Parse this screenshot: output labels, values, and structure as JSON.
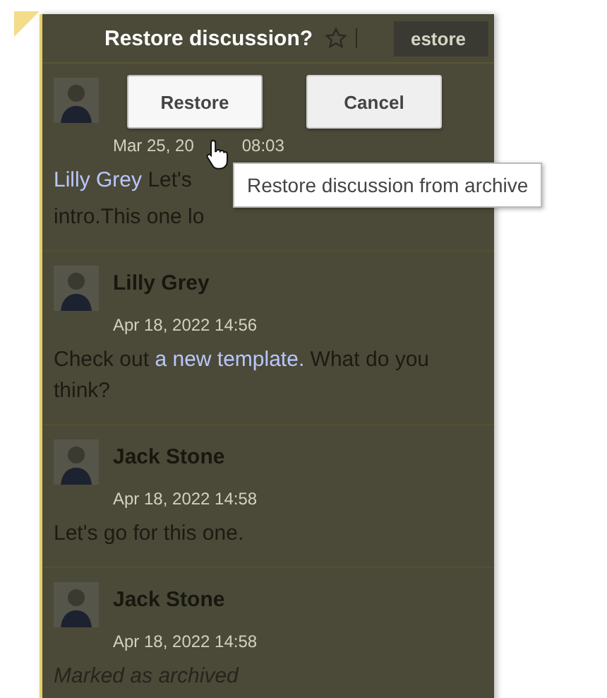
{
  "header": {
    "button": "estore"
  },
  "dialog": {
    "title": "Restore discussion?",
    "buttons": [
      {
        "label": "Restore",
        "hovered": true
      },
      {
        "label": "Cancel",
        "hovered": false
      }
    ],
    "tooltip": "Restore discussion from archive"
  },
  "messages": [
    {
      "date": "Mar 25, 20",
      "date_after_cursor": "08:03",
      "lines": [
        [
          {
            "kind": "link",
            "text": "Lilly Grey"
          },
          {
            "kind": "text",
            "text": "Let's"
          }
        ],
        [
          {
            "kind": "text",
            "text": "intro.This one lo"
          }
        ]
      ]
    },
    {
      "author": "Lilly Grey",
      "date": "Apr 18, 2022 14:56",
      "lines": [
        [
          {
            "kind": "text",
            "text": "Check out"
          },
          {
            "kind": "link",
            "text": "a new template."
          },
          {
            "kind": "text",
            "text": "What do you think?"
          }
        ]
      ]
    },
    {
      "author": "Jack Stone",
      "date": "Apr 18, 2022 14:58",
      "lines": [
        [
          {
            "kind": "text",
            "text": "Let's go for this one."
          }
        ]
      ]
    },
    {
      "author": "Jack Stone",
      "date": "Apr 18, 2022 14:58",
      "lines": [
        [
          {
            "kind": "note",
            "text": "Marked as archived"
          }
        ]
      ]
    }
  ]
}
